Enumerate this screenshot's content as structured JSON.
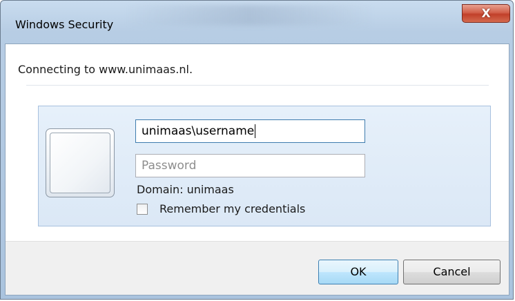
{
  "window": {
    "title": "Windows Security",
    "close_glyph": "X"
  },
  "dialog": {
    "message": "Connecting to www.unimaas.nl.",
    "username_value": "unimaas\\username",
    "password_placeholder": "Password",
    "domain_text": "Domain: unimaas",
    "remember_label": "Remember my credentials",
    "remember_checked": false,
    "user_tile_icon": "user-tile-icon"
  },
  "buttons": {
    "ok_label": "OK",
    "cancel_label": "Cancel"
  },
  "colors": {
    "frame": "#b7cde4",
    "close_button": "#c1402a",
    "panel": "#dbe8f6",
    "focus_border": "#3d7bad"
  }
}
